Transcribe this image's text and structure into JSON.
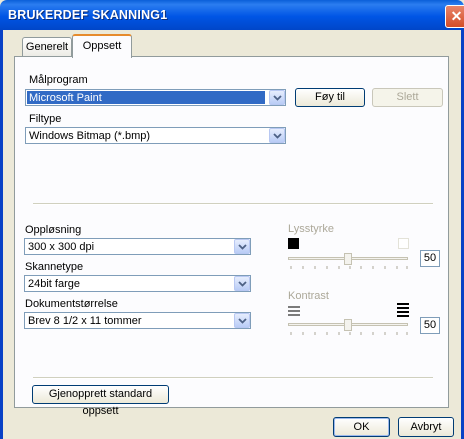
{
  "window": {
    "title": "BRUKERDEF SKANNING1",
    "close_glyph": "✕"
  },
  "tabs": [
    {
      "label": "Generelt",
      "active": false
    },
    {
      "label": "Oppsett",
      "active": true
    }
  ],
  "target_program": {
    "label": "Målprogram",
    "value": "Microsoft Paint",
    "add_button": "Føy til",
    "delete_button": "Slett"
  },
  "filetype": {
    "label": "Filtype",
    "value": "Windows Bitmap (*.bmp)"
  },
  "resolution": {
    "label": "Oppløsning",
    "value": "300 x 300 dpi"
  },
  "scan_type": {
    "label": "Skannetype",
    "value": "24bit farge"
  },
  "document_size": {
    "label": "Dokumentstørrelse",
    "value": "Brev 8 1/2 x 11 tommer"
  },
  "brightness": {
    "label": "Lysstyrke",
    "value": "50",
    "level_percent": 50,
    "enabled": false
  },
  "contrast": {
    "label": "Kontrast",
    "value": "50",
    "level_percent": 50,
    "enabled": false
  },
  "reset_button": "Gjenopprett standard oppsett",
  "footer": {
    "ok": "OK",
    "cancel": "Avbryt"
  },
  "colors": {
    "titlebar": "#0055e5",
    "selection": "#316ac5",
    "active_tab_accent": "#e68b2c"
  }
}
